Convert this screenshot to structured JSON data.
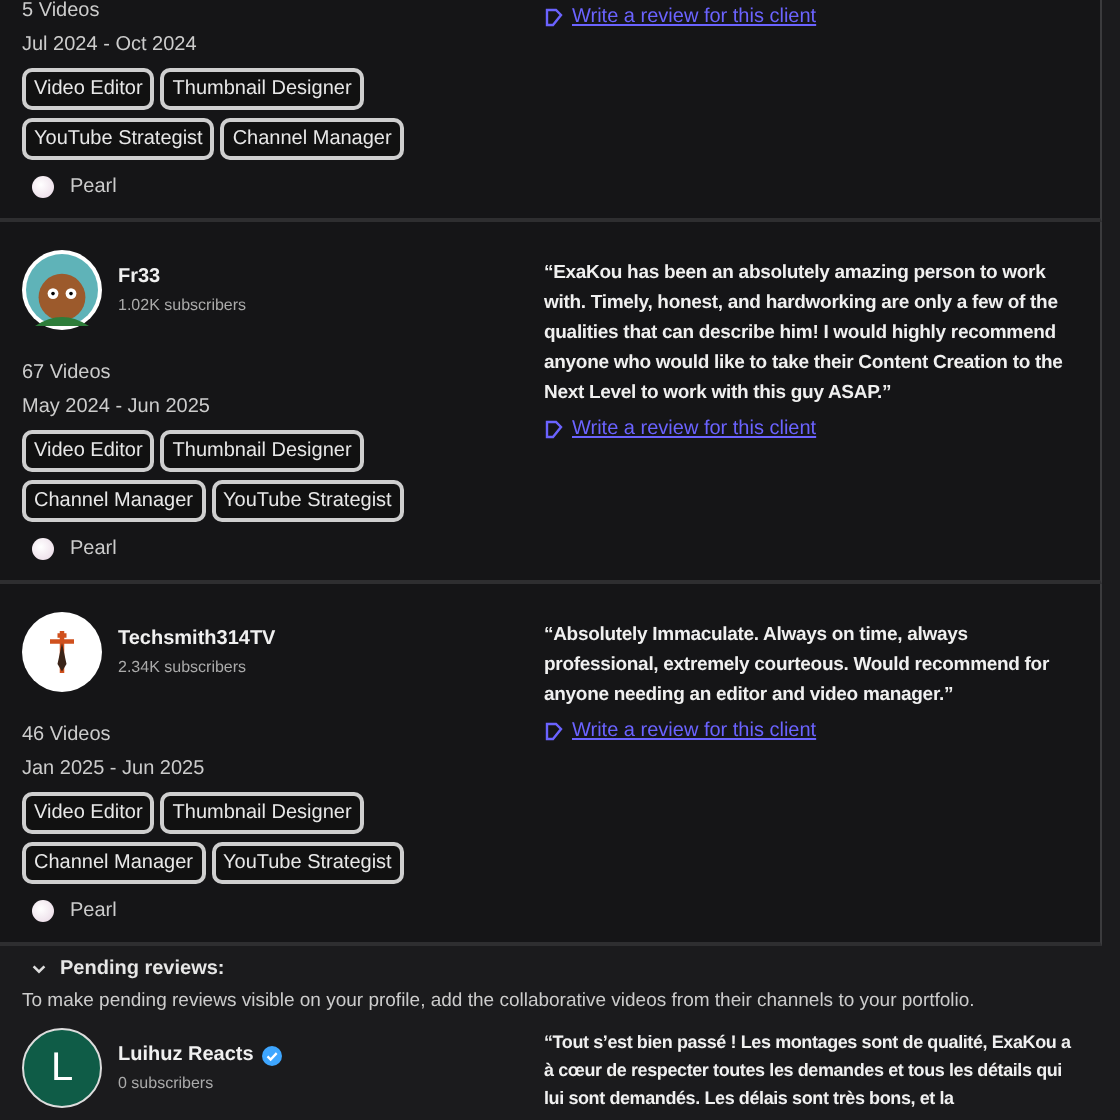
{
  "top_card": {
    "videos": "5 Videos",
    "dates": "Jul 2024 - Oct 2024",
    "roles": [
      "Video Editor",
      "Thumbnail Designer",
      "YouTube Strategist",
      "Channel Manager"
    ],
    "tier": "Pearl",
    "review_link": "Write a review for this client"
  },
  "reviews": [
    {
      "avatar": {
        "kind": "cartoon"
      },
      "name": "Fr33",
      "verified": false,
      "subscribers": "1.02K subscribers",
      "videos": "67 Videos",
      "dates": "May 2024 - Jun 2025",
      "roles": [
        "Video Editor",
        "Thumbnail Designer",
        "Channel Manager",
        "YouTube Strategist"
      ],
      "tier": "Pearl",
      "quote": "“ExaKou has been an absolutely amazing person to work with. Timely, honest, and hardworking are only a few of the qualities that can describe him! I would highly recommend anyone who would like to take their Content Creation to the Next Level to work with this guy ASAP.”",
      "review_link": "Write a review for this client"
    },
    {
      "avatar": {
        "kind": "sword"
      },
      "name": "Techsmith314TV",
      "verified": false,
      "subscribers": "2.34K subscribers",
      "videos": "46 Videos",
      "dates": "Jan 2025 - Jun 2025",
      "roles": [
        "Video Editor",
        "Thumbnail Designer",
        "Channel Manager",
        "YouTube Strategist"
      ],
      "tier": "Pearl",
      "quote": "“Absolutely Immaculate. Always on time, always professional, extremely courteous. Would recommend for anyone needing an editor and video manager.”",
      "review_link": "Write a review for this client"
    }
  ],
  "pending": {
    "expanded": true,
    "title": "Pending reviews:",
    "note": "To make pending reviews visible on your profile, add the collaborative videos from their channels to your portfolio.",
    "reviews": [
      {
        "avatar": {
          "kind": "letter",
          "letter": "L"
        },
        "name": "Luihuz Reacts",
        "verified": true,
        "subscribers": "0 subscribers",
        "quote": "“Tout s’est bien passé ! Les montages sont de qualité, ExaKou a à cœur de respecter toutes les demandes et tous les détails qui lui sont demandés. Les délais sont très bons, et la"
      }
    ]
  }
}
